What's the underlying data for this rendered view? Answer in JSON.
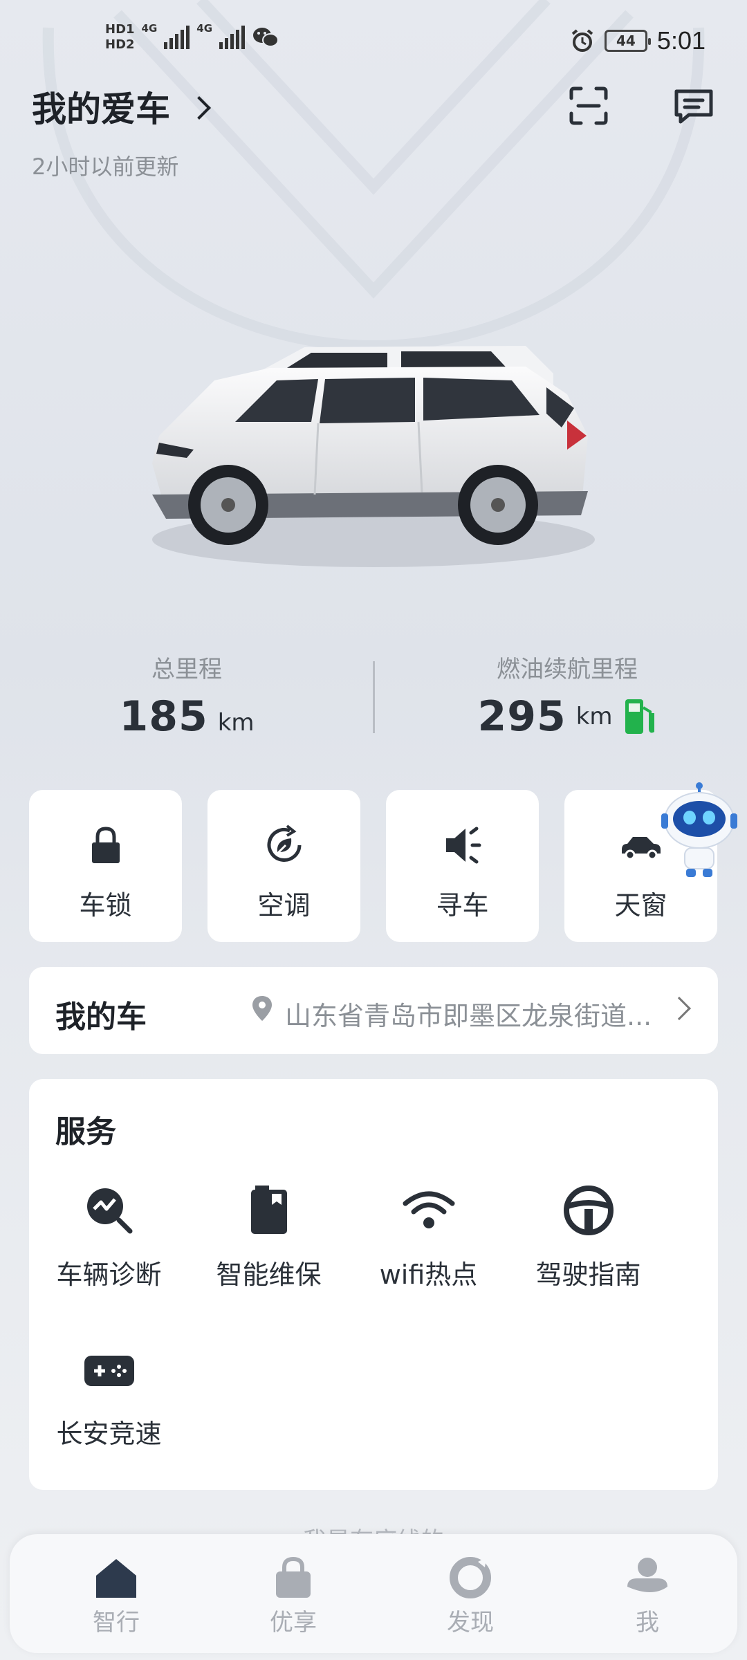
{
  "status_bar": {
    "sim1": "HD1",
    "sim2": "HD2",
    "net1": "4G",
    "net2": "4G",
    "battery": "44",
    "time": "5:01"
  },
  "header": {
    "title": "我的爱车",
    "updated": "2小时以前更新"
  },
  "stats": {
    "total_label": "总里程",
    "total_value": "185",
    "total_unit": "km",
    "range_label": "燃油续航里程",
    "range_value": "295",
    "range_unit": "km",
    "fuel_color": "#22b24c"
  },
  "quick_controls": [
    {
      "label": "车锁",
      "icon": "lock-icon"
    },
    {
      "label": "空调",
      "icon": "ac-icon"
    },
    {
      "label": "寻车",
      "icon": "horn-icon"
    },
    {
      "label": "天窗",
      "icon": "car-roof-icon"
    }
  ],
  "my_car": {
    "title": "我的车",
    "address": "山东省青岛市即墨区龙泉街道..."
  },
  "services": {
    "title": "服务",
    "items": [
      {
        "label": "车辆诊断",
        "icon": "diagnosis-icon"
      },
      {
        "label": "智能维保",
        "icon": "maintenance-icon"
      },
      {
        "label": "wifi热点",
        "icon": "wifi-icon"
      },
      {
        "label": "驾驶指南",
        "icon": "steering-wheel-icon"
      },
      {
        "label": "长安竞速",
        "icon": "gamepad-icon"
      }
    ]
  },
  "peek_text": "我是有底线的",
  "nav": [
    {
      "label": "智行",
      "icon": "home-icon",
      "active": true
    },
    {
      "label": "优享",
      "icon": "bag-icon"
    },
    {
      "label": "发现",
      "icon": "discover-icon"
    },
    {
      "label": "我",
      "icon": "profile-icon"
    }
  ],
  "colors": {
    "accent": "#3a4350",
    "card": "#ffffff",
    "muted": "#8b9096"
  }
}
